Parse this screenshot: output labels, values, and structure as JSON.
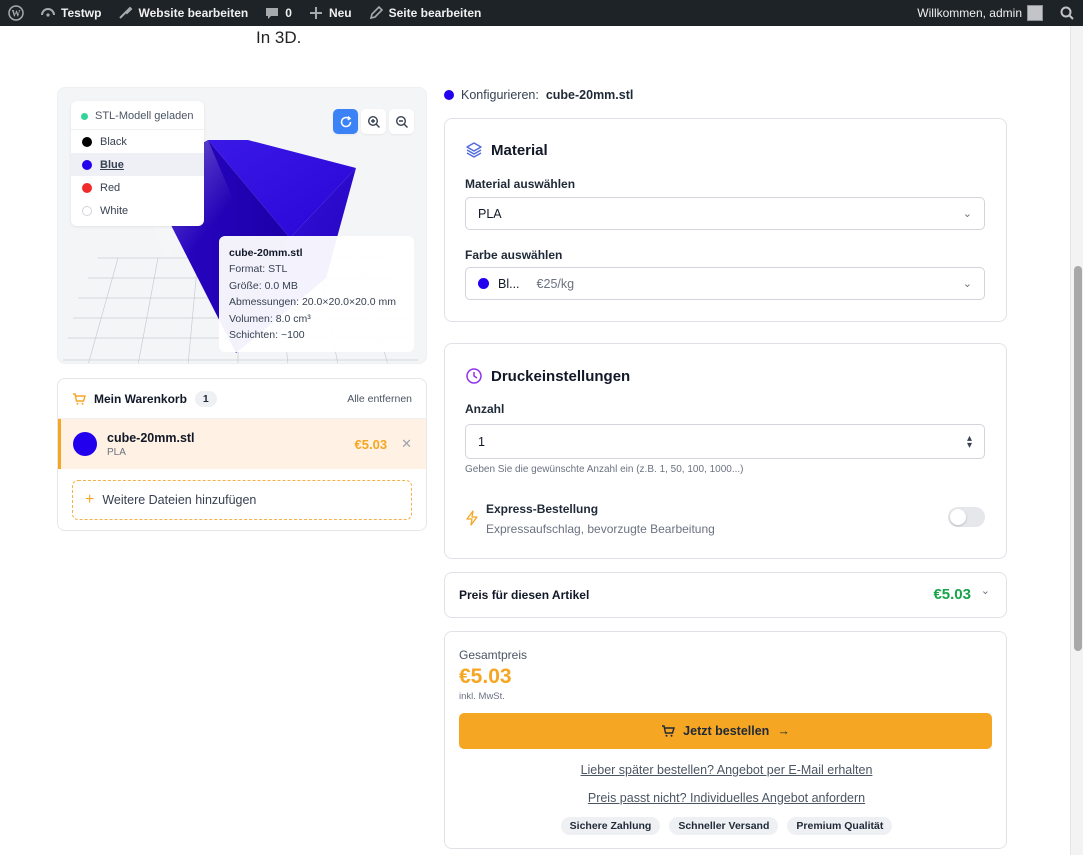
{
  "adminbar": {
    "site_name": "Testwp",
    "edit_site": "Website bearbeiten",
    "comments_count": "0",
    "new_label": "Neu",
    "edit_page": "Seite bearbeiten",
    "welcome": "Willkommen, admin"
  },
  "page": {
    "top_text": "In 3D."
  },
  "viewer": {
    "status": "STL-Modell geladen",
    "colors": [
      {
        "label": "Black",
        "color": "#000000"
      },
      {
        "label": "Blue",
        "color": "#2200ee"
      },
      {
        "label": "Red",
        "color": "#ef2b2b"
      },
      {
        "label": "White",
        "color": "#ffffff"
      }
    ],
    "selected_color": "Blue",
    "info": {
      "filename": "cube-20mm.stl",
      "format": "Format: STL",
      "size": "Größe: 0.0 MB",
      "dimensions": "Abmessungen: 20.0×20.0×20.0 mm",
      "volume": "Volumen: 8.0 cm³",
      "layers": "Schichten: ~100"
    }
  },
  "cart": {
    "title": "Mein Warenkorb",
    "count": "1",
    "remove_all": "Alle entfernen",
    "item": {
      "name": "cube-20mm.stl",
      "material": "PLA",
      "price": "€5.03"
    },
    "add_more": "Weitere Dateien hinzufügen"
  },
  "config": {
    "heading_prefix": "Konfigurieren:",
    "heading_file": "cube-20mm.stl",
    "material": {
      "title": "Material",
      "select_label": "Material auswählen",
      "selected": "PLA",
      "color_label": "Farbe auswählen",
      "color_name": "Bl...",
      "color_price": "€25/kg"
    },
    "print": {
      "title": "Druckeinstellungen",
      "qty_label": "Anzahl",
      "qty_value": "1",
      "qty_hint": "Geben Sie die gewünschte Anzahl ein (z.B. 1, 50, 100, 1000...)",
      "express_title": "Express-Bestellung",
      "express_desc": "Expressaufschlag, bevorzugte Bearbeitung",
      "express_on": false
    },
    "price_row": {
      "label": "Preis für diesen Artikel",
      "value": "€5.03"
    },
    "total": {
      "label": "Gesamtpreis",
      "value": "€5.03",
      "tax_note": "inkl. MwSt.",
      "order_button": "Jetzt bestellen",
      "link_later": "Lieber später bestellen? Angebot per E-Mail erhalten",
      "link_custom": "Preis passt nicht? Individuelles Angebot anfordern",
      "badges": [
        "Sichere Zahlung",
        "Schneller Versand",
        "Premium Qualität"
      ]
    }
  },
  "colors": {
    "accent": "#f5a623",
    "price_green": "#16a34a",
    "model_blue": "#2200ee",
    "primary_blue": "#3b82f6"
  }
}
